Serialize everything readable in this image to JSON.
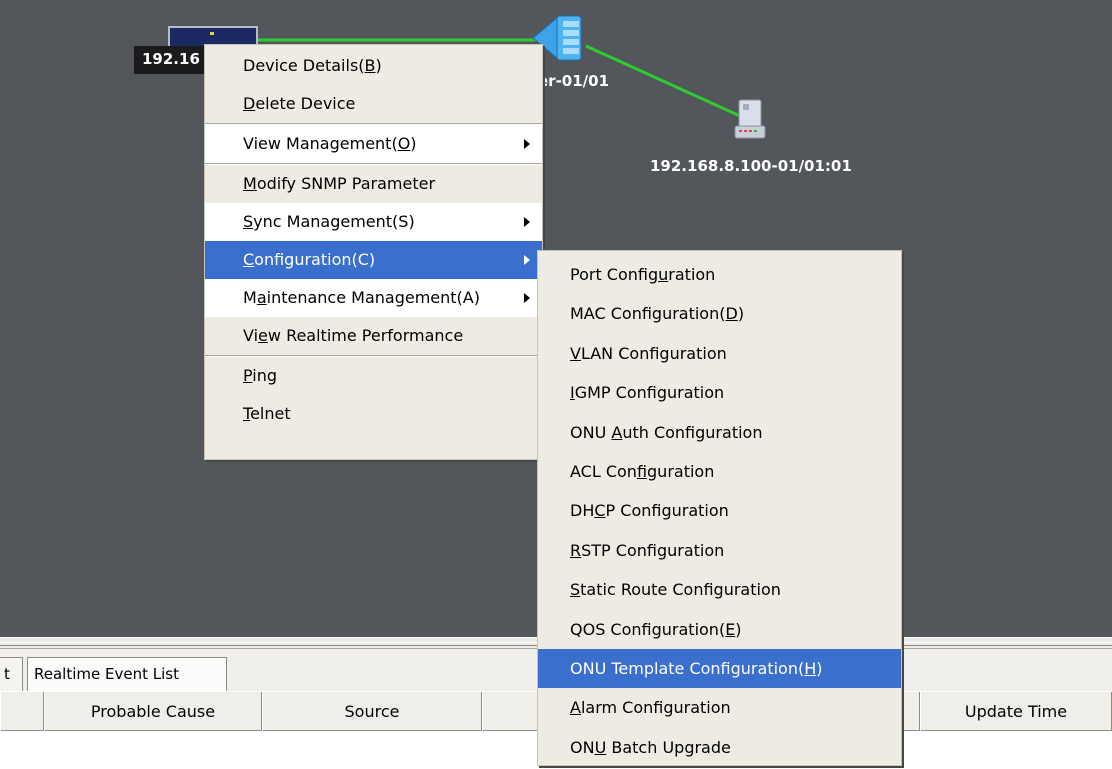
{
  "topology": {
    "left_device_label": "192.16",
    "middle_device_label": "er-01/01",
    "right_device_label": "192.168.8.100-01/01:01",
    "link_color": "#2ecc2e"
  },
  "context_menu": {
    "items": [
      {
        "label": "Device Details(B)",
        "accel": "B"
      },
      {
        "label": "Delete Device",
        "accel": "D"
      },
      {
        "label": "View Management(O)",
        "accel": "O",
        "submenu": true
      },
      {
        "label": "Modify SNMP Parameter",
        "accel": "M"
      },
      {
        "label": "Sync Management(S)",
        "accel": "S",
        "submenu": true
      },
      {
        "label": "Configuration(C)",
        "accel": "C",
        "submenu": true,
        "selected": true
      },
      {
        "label": "Maintenance Management(A)",
        "accel": "a",
        "submenu": true
      },
      {
        "label": "View Realtime Performance",
        "accel": "e"
      },
      {
        "label": "Ping",
        "accel": "P"
      },
      {
        "label": "Telnet",
        "accel": "T"
      }
    ]
  },
  "configuration_submenu": {
    "items": [
      {
        "label": "Port Configuration",
        "accel": "u"
      },
      {
        "label": "MAC Configuration(D)",
        "accel": "D"
      },
      {
        "label": "VLAN Configuration",
        "accel": "V"
      },
      {
        "label": "IGMP Configuration",
        "accel": "I"
      },
      {
        "label": "ONU Auth Configuration",
        "accel": "A"
      },
      {
        "label": "ACL Configuration",
        "accel": "f"
      },
      {
        "label": "DHCP Configuration",
        "accel": "C"
      },
      {
        "label": "RSTP Configuration",
        "accel": "R"
      },
      {
        "label": "Static Route Configuration",
        "accel": "S"
      },
      {
        "label": "QOS Configuration(E)",
        "accel": "E"
      },
      {
        "label": "ONU Template Configuration(H)",
        "accel": "H",
        "selected": true
      },
      {
        "label": "Alarm Configuration",
        "accel": "A"
      },
      {
        "label": "ONU Batch Upgrade",
        "accel": "U"
      }
    ]
  },
  "tabs": {
    "partial_tab": "t",
    "realtime_event_list": "Realtime Event List"
  },
  "table": {
    "columns": [
      "",
      "Probable Cause",
      "Source",
      "",
      "Update Time"
    ]
  },
  "colors": {
    "canvas_bg": "#53565b",
    "menu_bg": "#edebe2",
    "menu_selected": "#3a6fcd",
    "menu_alt": "#ffffff"
  }
}
